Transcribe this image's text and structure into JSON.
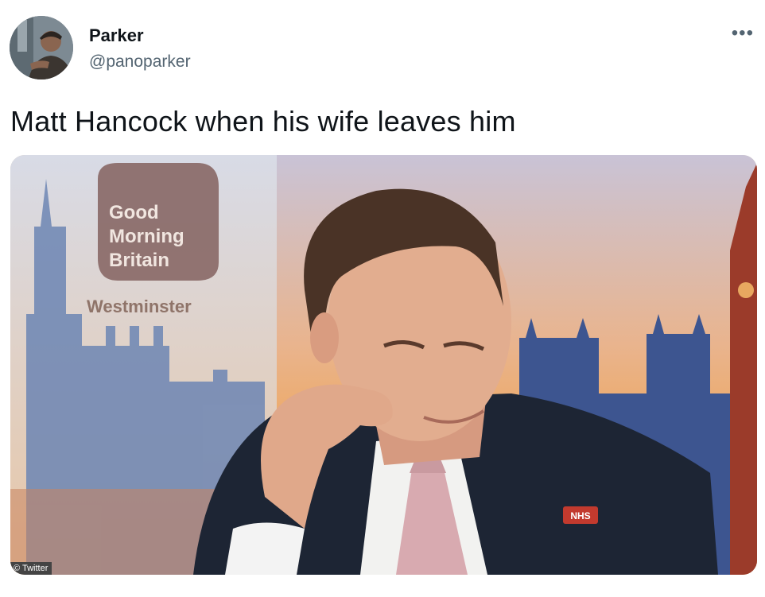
{
  "tweet": {
    "author_name": "Parker",
    "author_handle": "@panoparker",
    "more_label": "•••",
    "text": "Matt Hancock when his wife leaves him"
  },
  "media": {
    "logo_lines": [
      "Good",
      "Morning",
      "Britain"
    ],
    "location": "Westminster",
    "badge": "NHS"
  },
  "credit": "© Twitter",
  "colors": {
    "name": "#0f1419",
    "handle": "#536471",
    "sunset": "#f0a24a"
  }
}
